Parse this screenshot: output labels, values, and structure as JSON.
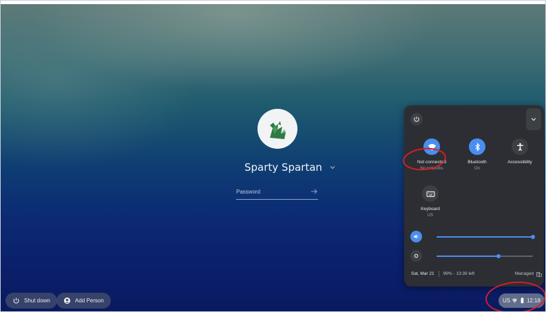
{
  "user": {
    "name": "Sparty Spartan",
    "password_placeholder": "Password"
  },
  "shelf": {
    "shutdown_label": "Shut down",
    "add_person_label": "Add Person"
  },
  "status_tray": {
    "keyboard_layout": "US",
    "time": "12:18"
  },
  "quick_settings": {
    "tiles": [
      {
        "label": "Not connected",
        "sublabel": "No networks",
        "icon": "wifi-icon",
        "active": true
      },
      {
        "label": "Bluetooth",
        "sublabel": "On",
        "icon": "bluetooth-icon",
        "active": true
      },
      {
        "label": "Accessibility",
        "sublabel": "",
        "icon": "accessibility-icon",
        "active": false
      },
      {
        "label": "Keyboard",
        "sublabel": "US",
        "icon": "keyboard-icon",
        "active": false
      }
    ],
    "volume_level": 1.0,
    "brightness_level": 0.64,
    "date": "Sat, Mar 21",
    "battery": "99% - 13:39 left",
    "managed_label": "Managed"
  },
  "colors": {
    "accent": "#4a8ef0",
    "panel_bg": "#2c2e33",
    "annotation": "#d21f2a"
  }
}
